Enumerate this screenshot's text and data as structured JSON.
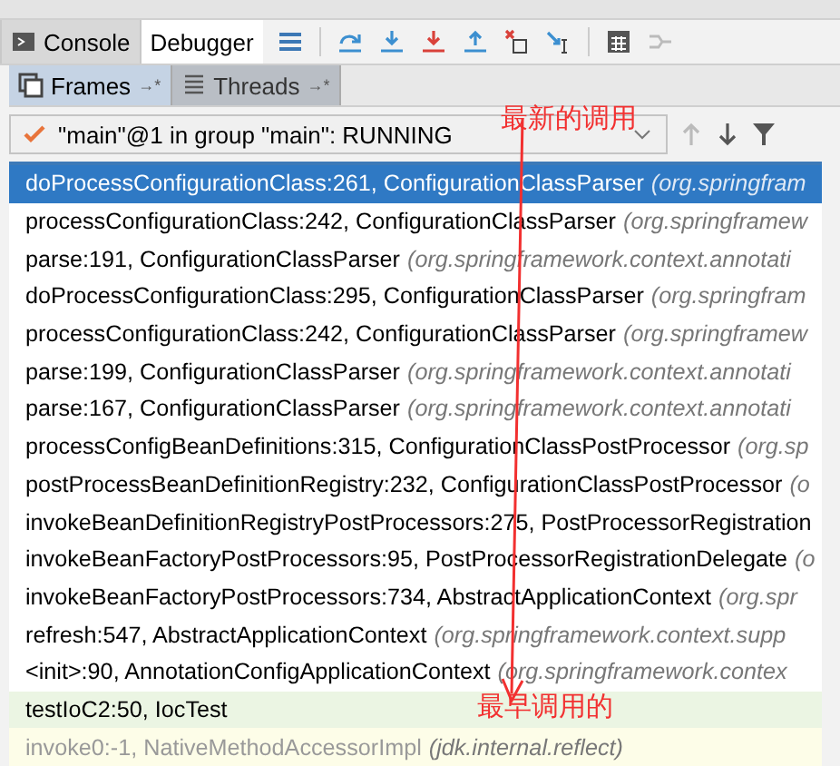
{
  "tabs": [
    {
      "label": "Console",
      "selected": false
    },
    {
      "label": "Debugger",
      "selected": true
    }
  ],
  "panel_tabs": [
    {
      "label": "Frames",
      "pin": "→*",
      "selected": true
    },
    {
      "label": "Threads",
      "pin": "→*",
      "selected": false
    }
  ],
  "thread_selector": {
    "value": "\"main\"@1 in group \"main\": RUNNING"
  },
  "frames": [
    {
      "method": "doProcessConfigurationClass:261, ConfigurationClassParser",
      "package": "(org.springfram",
      "kind": "normal",
      "selected": true
    },
    {
      "method": "processConfigurationClass:242, ConfigurationClassParser",
      "package": "(org.springframew",
      "kind": "normal",
      "selected": false
    },
    {
      "method": "parse:191, ConfigurationClassParser",
      "package": "(org.springframework.context.annotati",
      "kind": "normal",
      "selected": false
    },
    {
      "method": "doProcessConfigurationClass:295, ConfigurationClassParser",
      "package": "(org.springfram",
      "kind": "normal",
      "selected": false
    },
    {
      "method": "processConfigurationClass:242, ConfigurationClassParser",
      "package": "(org.springframew",
      "kind": "normal",
      "selected": false
    },
    {
      "method": "parse:199, ConfigurationClassParser",
      "package": "(org.springframework.context.annotati",
      "kind": "normal",
      "selected": false
    },
    {
      "method": "parse:167, ConfigurationClassParser",
      "package": "(org.springframework.context.annotati",
      "kind": "normal",
      "selected": false
    },
    {
      "method": "processConfigBeanDefinitions:315, ConfigurationClassPostProcessor",
      "package": "(org.sp",
      "kind": "normal",
      "selected": false
    },
    {
      "method": "postProcessBeanDefinitionRegistry:232, ConfigurationClassPostProcessor",
      "package": "(o",
      "kind": "normal",
      "selected": false
    },
    {
      "method": "invokeBeanDefinitionRegistryPostProcessors:275, PostProcessorRegistration",
      "kind": "normal",
      "selected": false
    },
    {
      "method": "invokeBeanFactoryPostProcessors:95, PostProcessorRegistrationDelegate",
      "package": "(o",
      "kind": "normal",
      "selected": false
    },
    {
      "method": "invokeBeanFactoryPostProcessors:734, AbstractApplicationContext",
      "package": "(org.spr",
      "kind": "normal",
      "selected": false
    },
    {
      "method": "refresh:547, AbstractApplicationContext",
      "package": "(org.springframework.context.supp",
      "kind": "normal",
      "selected": false
    },
    {
      "method": "<init>:90, AnnotationConfigApplicationContext",
      "package": "(org.springframework.contex",
      "kind": "normal",
      "selected": false
    },
    {
      "method": "testIoC2:50, IocTest",
      "kind": "user",
      "selected": false
    },
    {
      "method": "invoke0:-1, NativeMethodAccessorImpl",
      "package": "(jdk.internal.reflect)",
      "kind": "library",
      "selected": false
    }
  ],
  "annotations": [
    {
      "text": "最新的调用"
    },
    {
      "text": "最早调用的"
    }
  ]
}
